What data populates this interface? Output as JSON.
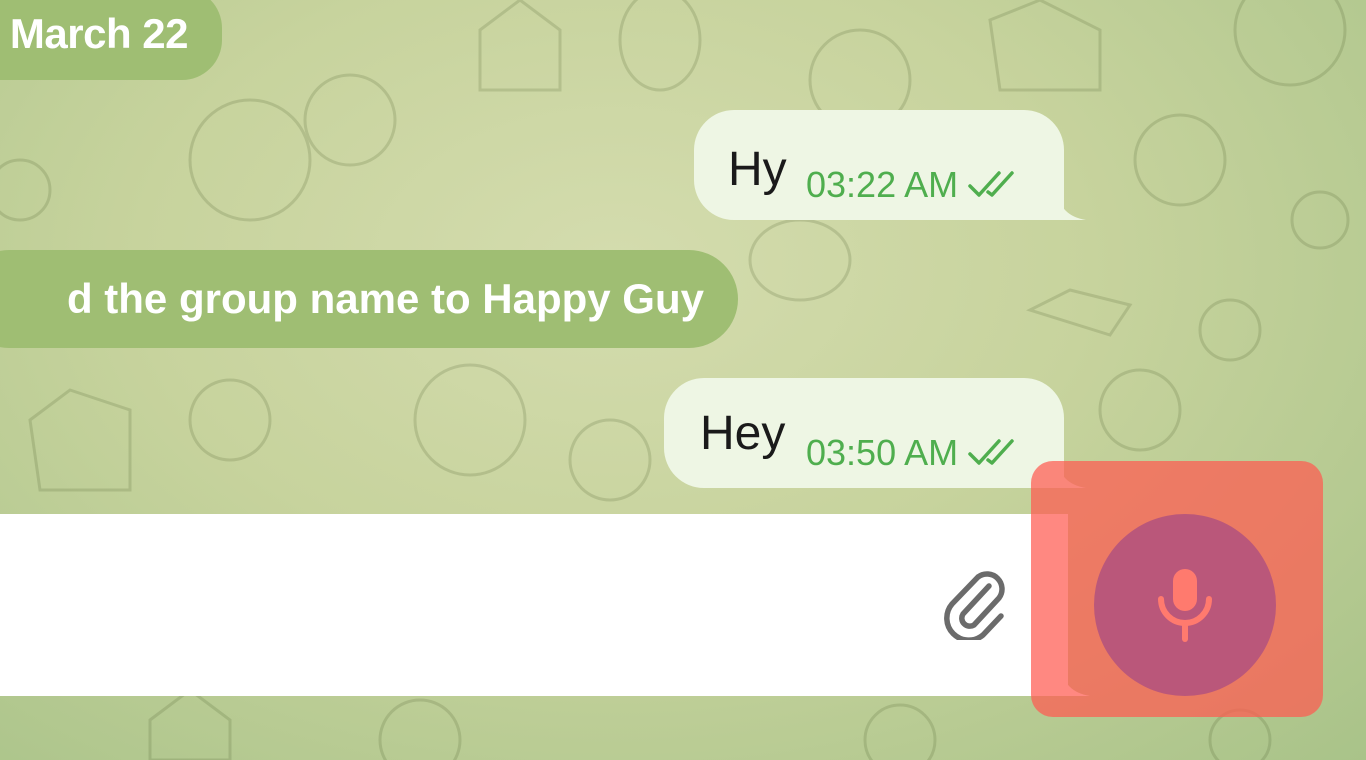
{
  "chat": {
    "date_separator": "March 22",
    "service_message": "d the group name to Happy Guy",
    "messages": [
      {
        "text": "Hy",
        "time": "03:22 AM",
        "status": "read"
      },
      {
        "text": "Hey",
        "time": "03:50 AM",
        "status": "read"
      }
    ]
  },
  "composer": {
    "input_value": "",
    "attach_icon": "paperclip-icon",
    "mic_icon": "microphone-icon"
  },
  "colors": {
    "bubble_outgoing": "#eef6e4",
    "time_green": "#4fae4e",
    "service_pill": "#9fbe73",
    "mic_button": "#ba577a",
    "highlight": "#ff5a50"
  }
}
